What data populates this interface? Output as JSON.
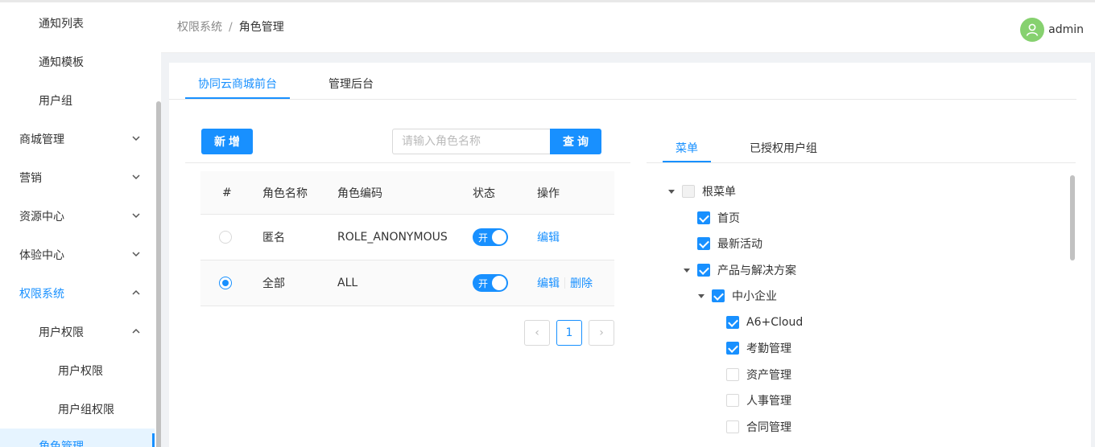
{
  "sidebar": {
    "items": [
      {
        "label": "通知列表"
      },
      {
        "label": "通知模板"
      },
      {
        "label": "用户组"
      },
      {
        "label": "商城管理"
      },
      {
        "label": "营销"
      },
      {
        "label": "资源中心"
      },
      {
        "label": "体验中心"
      },
      {
        "label": "权限系统"
      },
      {
        "label": "用户权限"
      },
      {
        "label": "用户权限"
      },
      {
        "label": "用户组权限"
      },
      {
        "label": "角色管理"
      }
    ]
  },
  "header": {
    "breadcrumb": {
      "parent": "权限系统",
      "separator": "/",
      "current": "角色管理"
    },
    "user": {
      "name": "admin",
      "avatar_icon": "user-icon",
      "avatar_color": "#86d16f"
    }
  },
  "tabs": [
    {
      "label": "协同云商城前台",
      "active": true
    },
    {
      "label": "管理后台",
      "active": false
    }
  ],
  "toolbar": {
    "add_label": "新增",
    "search_placeholder": "请输入角色名称",
    "search_value": "",
    "query_label": "查询"
  },
  "table": {
    "columns": [
      "#",
      "角色名称",
      "角色编码",
      "状态",
      "操作"
    ],
    "rows": [
      {
        "selected": false,
        "name": "匿名",
        "code": "ROLE_ANONYMOUS",
        "status": "开",
        "actions": [
          "编辑"
        ]
      },
      {
        "selected": true,
        "name": "全部",
        "code": "ALL",
        "status": "开",
        "actions": [
          "编辑",
          "删除"
        ]
      }
    ]
  },
  "pagination": {
    "prev": "‹",
    "page": "1",
    "next": "›"
  },
  "right_panel": {
    "tabs": [
      {
        "label": "菜单",
        "active": true
      },
      {
        "label": "已授权用户组",
        "active": false
      }
    ],
    "tree": [
      {
        "label": "根菜单",
        "checked": false,
        "expanded": true,
        "disabled": true
      },
      {
        "label": "首页",
        "checked": true
      },
      {
        "label": "最新活动",
        "checked": true
      },
      {
        "label": "产品与解决方案",
        "checked": true,
        "expanded": true
      },
      {
        "label": "中小企业",
        "checked": true,
        "expanded": true
      },
      {
        "label": "A6+Cloud",
        "checked": true
      },
      {
        "label": "考勤管理",
        "checked": true
      },
      {
        "label": "资产管理",
        "checked": false
      },
      {
        "label": "人事管理",
        "checked": false
      },
      {
        "label": "合同管理",
        "checked": false
      }
    ]
  },
  "colors": {
    "primary": "#1890ff",
    "selected_bg": "#e6f4ff"
  }
}
